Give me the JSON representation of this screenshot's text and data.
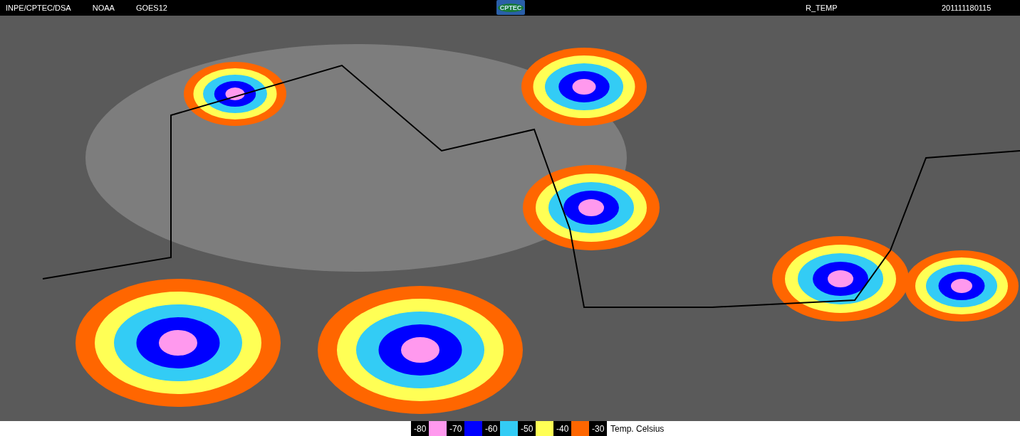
{
  "header": {
    "labels": [
      "INPE/CPTEC/DSA",
      "NOAA",
      "GOES12"
    ],
    "logo": "CPTEC",
    "product": "R_TEMP",
    "timestamp": "201111180115"
  },
  "legend": {
    "items": [
      {
        "label": "-80",
        "color": "#ff99ee"
      },
      {
        "label": "-70",
        "color": "#0000ff"
      },
      {
        "label": "-60",
        "color": "#33ccf5"
      },
      {
        "label": "-50",
        "color": "#ffff55"
      },
      {
        "label": "-40",
        "color": "#ff6600"
      },
      {
        "label": "-30"
      }
    ],
    "unit": "Temp. Celsius"
  }
}
